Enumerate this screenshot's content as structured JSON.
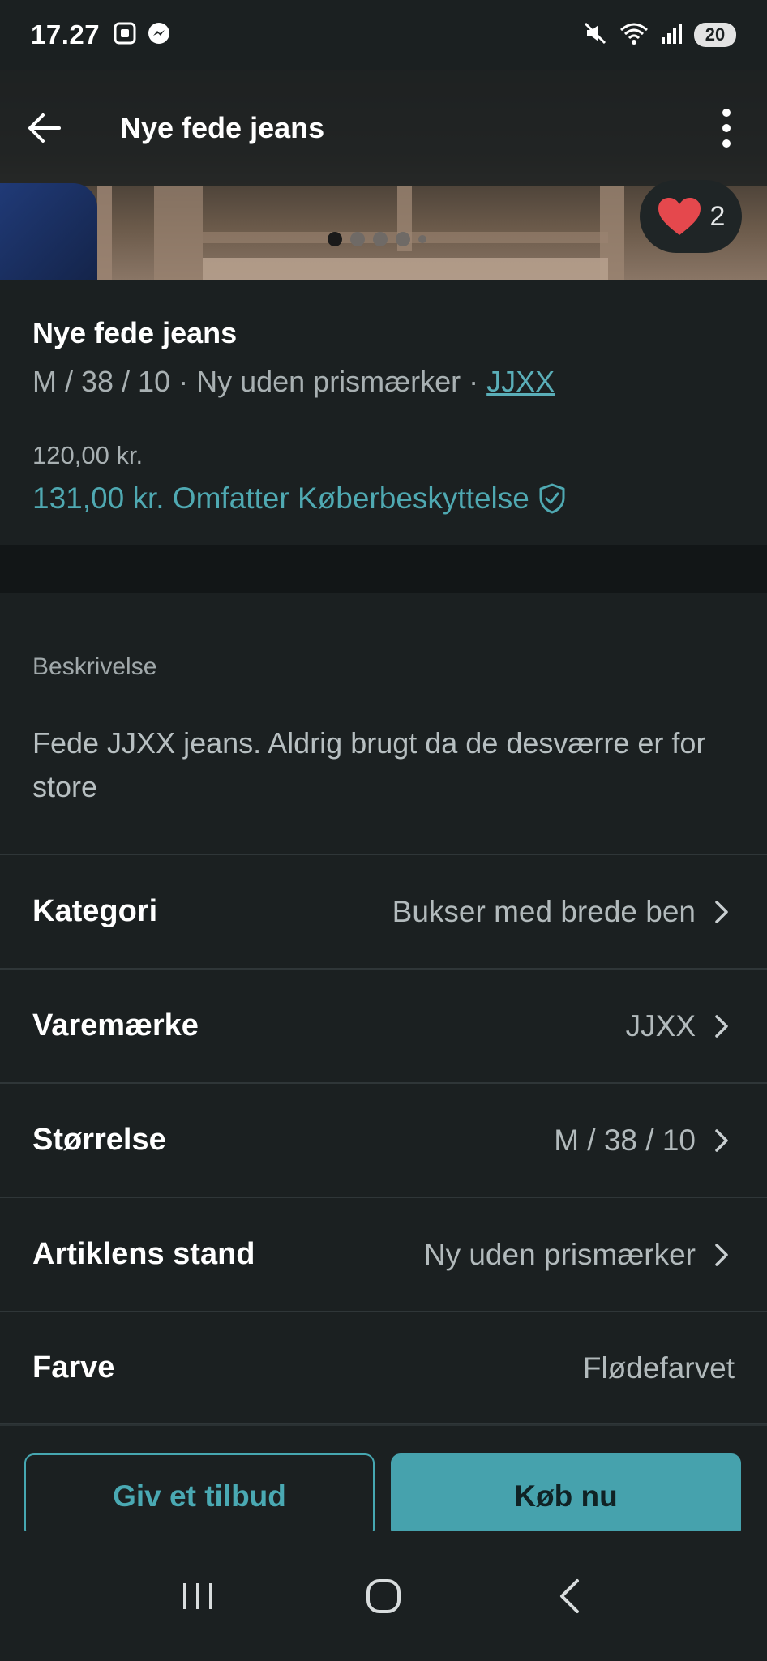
{
  "status_bar": {
    "time": "17.27",
    "battery": "20",
    "icons": [
      "screenshot-icon",
      "messenger-icon",
      "mute-icon",
      "wifi-icon",
      "signal-icon",
      "battery-icon"
    ]
  },
  "header": {
    "title": "Nye fede jeans",
    "back_icon": "arrow-left-icon",
    "more_icon": "more-vertical-icon"
  },
  "gallery": {
    "favorites_count": "2",
    "dots_total": 5,
    "active_dot": 1
  },
  "item": {
    "title": "Nye fede jeans",
    "subtitle_prefix": "M / 38 / 10 · Ny uden prismærker · ",
    "brand_link": "JJXX",
    "price": "120,00 kr.",
    "total_price": "131,00 kr. Omfatter Køberbeskyttelse"
  },
  "description": {
    "label": "Beskrivelse",
    "text": "Fede JJXX jeans. Aldrig brugt da de desværre er for store"
  },
  "details": [
    {
      "label": "Kategori",
      "value": "Bukser med brede ben",
      "chevron": true
    },
    {
      "label": "Varemærke",
      "value": "JJXX",
      "chevron": true
    },
    {
      "label": "Størrelse",
      "value": "M / 38 / 10",
      "chevron": true
    },
    {
      "label": "Artiklens stand",
      "value": "Ny uden prismærker",
      "chevron": true
    },
    {
      "label": "Farve",
      "value": "Flødefarvet",
      "chevron": false
    }
  ],
  "actions": {
    "offer": "Giv et tilbud",
    "buy": "Køb nu"
  },
  "colors": {
    "accent": "#46a2ad",
    "background": "#1b2021",
    "heart": "#e5484d"
  }
}
